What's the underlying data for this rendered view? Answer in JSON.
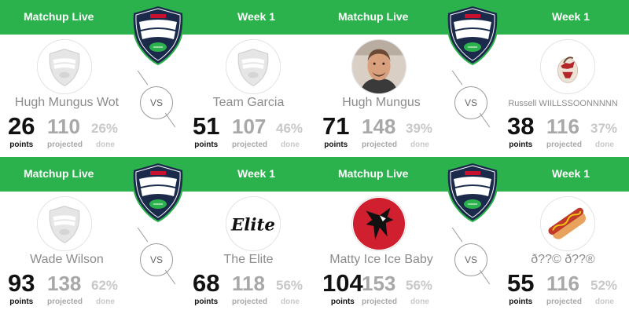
{
  "colors": {
    "header": "#2bb24c",
    "logo_navy": "#1b2a4a",
    "logo_green": "#2bb24c"
  },
  "matchups": [
    {
      "header_left": "Matchup Live",
      "header_right": "Week 1",
      "vs": "VS",
      "home": {
        "name": "Hugh Mungus Wot",
        "avatar": "fantasy-football-placeholder",
        "points": "26",
        "projected": "110",
        "done": "26%"
      },
      "away": {
        "name": "Team Garcia",
        "avatar": "fantasy-football-placeholder",
        "points": "51",
        "projected": "107",
        "done": "46%"
      },
      "labels": {
        "points": "points",
        "projected": "projected",
        "done": "done"
      }
    },
    {
      "header_left": "Matchup Live",
      "header_right": "Week 1",
      "vs": "VS",
      "home": {
        "name": "Hugh Mungus",
        "avatar": "man-photo",
        "points": "71",
        "projected": "148",
        "done": "39%"
      },
      "away": {
        "name": "Russell WIILLSSOONNNNN",
        "avatar": "wilson-volleyball",
        "points": "38",
        "projected": "116",
        "done": "37%"
      },
      "labels": {
        "points": "points",
        "projected": "projected",
        "done": "done"
      }
    },
    {
      "header_left": "Matchup Live",
      "header_right": "Week 1",
      "vs": "VS",
      "home": {
        "name": "Wade Wilson",
        "avatar": "fantasy-football-placeholder",
        "points": "93",
        "projected": "138",
        "done": "62%"
      },
      "away": {
        "name": "The Elite",
        "avatar": "elite-script-logo",
        "logo_text": "Elite",
        "points": "68",
        "projected": "118",
        "done": "56%"
      },
      "labels": {
        "points": "points",
        "projected": "projected",
        "done": "done"
      }
    },
    {
      "header_left": "Matchup Live",
      "header_right": "Week 1",
      "vs": "VS",
      "home": {
        "name": "Matty Ice Ice Baby",
        "avatar": "falcons-logo",
        "points": "104",
        "projected": "153",
        "done": "56%"
      },
      "away": {
        "name": "ð??© ð??®",
        "avatar": "hotdog-emoji",
        "points": "55",
        "projected": "116",
        "done": "52%"
      },
      "labels": {
        "points": "points",
        "projected": "projected",
        "done": "done"
      }
    }
  ]
}
